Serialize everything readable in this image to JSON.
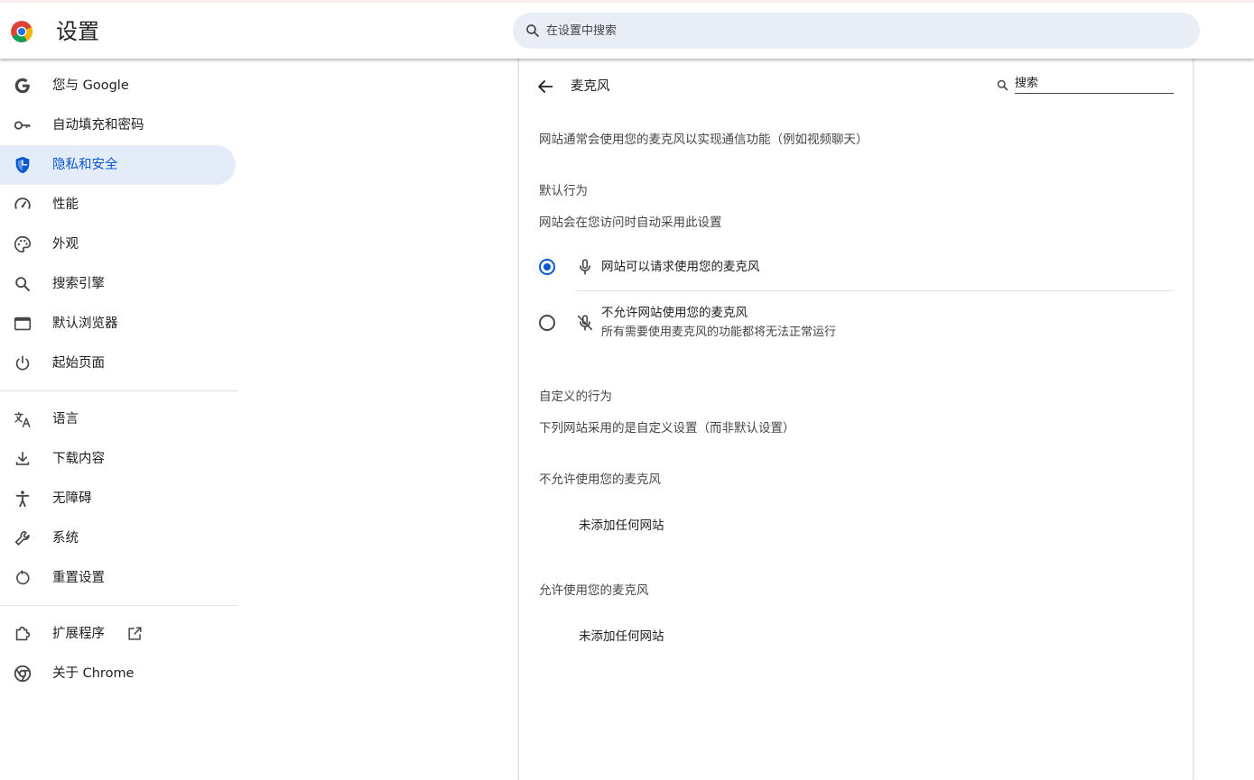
{
  "app": {
    "title": "设置"
  },
  "search": {
    "placeholder": "在设置中搜索"
  },
  "sidebar": {
    "groups": [
      {
        "items": [
          {
            "label": "您与 Google",
            "icon": "google-g-icon"
          },
          {
            "label": "自动填充和密码",
            "icon": "key-icon"
          },
          {
            "label": "隐私和安全",
            "icon": "shield-icon",
            "active": true
          },
          {
            "label": "性能",
            "icon": "speedometer-icon"
          },
          {
            "label": "外观",
            "icon": "palette-icon"
          },
          {
            "label": "搜索引擎",
            "icon": "search-icon"
          },
          {
            "label": "默认浏览器",
            "icon": "browser-window-icon"
          },
          {
            "label": "起始页面",
            "icon": "power-icon"
          }
        ]
      },
      {
        "items": [
          {
            "label": "语言",
            "icon": "translate-icon"
          },
          {
            "label": "下载内容",
            "icon": "download-icon"
          },
          {
            "label": "无障碍",
            "icon": "accessibility-icon"
          },
          {
            "label": "系统",
            "icon": "wrench-icon"
          },
          {
            "label": "重置设置",
            "icon": "reset-icon"
          }
        ]
      },
      {
        "items": [
          {
            "label": "扩展程序",
            "icon": "puzzle-icon",
            "external_icon": "open-in-new-icon"
          },
          {
            "label": "关于 Chrome",
            "icon": "chrome-icon"
          }
        ]
      }
    ]
  },
  "panel": {
    "title": "麦克风",
    "search_placeholder": "搜索",
    "description": "网站通常会使用您的麦克风以实现通信功能（例如视频聊天）",
    "default_behavior": {
      "heading": "默认行为",
      "subtitle": "网站会在您访问时自动采用此设置",
      "options": [
        {
          "label": "网站可以请求使用您的麦克风",
          "selected": true,
          "icon": "microphone-icon"
        },
        {
          "label": "不允许网站使用您的麦克风",
          "sublabel": "所有需要使用麦克风的功能都将无法正常运行",
          "selected": false,
          "icon": "microphone-off-icon"
        }
      ]
    },
    "custom_behavior": {
      "heading": "自定义的行为",
      "subtitle": "下列网站采用的是自定义设置（而非默认设置）",
      "blocked": {
        "heading": "不允许使用您的麦克风",
        "empty": "未添加任何网站"
      },
      "allowed": {
        "heading": "允许使用您的麦克风",
        "empty": "未添加任何网站"
      }
    }
  },
  "colors": {
    "accent": "#0b57d0",
    "active_bg": "#e4ecf9",
    "search_bg": "#e9eef6"
  }
}
